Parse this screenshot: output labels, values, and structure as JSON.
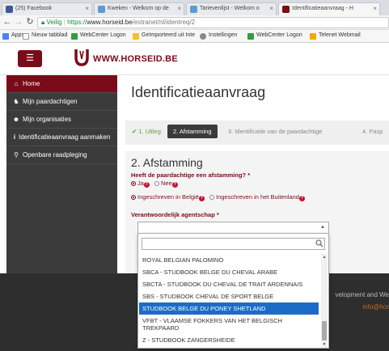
{
  "browser": {
    "tabs": [
      {
        "label": "(25) Facebook",
        "color": "#3b5998"
      },
      {
        "label": "Kweken - Welkom op de",
        "color": "#5b9bd5"
      },
      {
        "label": "Tarievenlijst - Welkom o",
        "color": "#5b9bd5"
      },
      {
        "label": "Identificatieaanvraag - H",
        "color": "#7a0c1a"
      }
    ],
    "url": {
      "secure_label": "Veilig",
      "protocol": "https://",
      "host": "www.horseid.be",
      "path": "/extranet/nl/identreq/2"
    },
    "bookmarks": [
      {
        "label": "Apps",
        "color": "#4285f4"
      },
      {
        "label": "Nieuw tabblad",
        "color": "#bbbbbb"
      },
      {
        "label": "WebCenter Logon",
        "color": "#2e9e44"
      },
      {
        "label": "Geïmporteerd uit Inte",
        "color": "#f2c12e"
      },
      {
        "label": "Instellingen",
        "color": "#888888"
      },
      {
        "label": "WebCenter Logon",
        "color": "#2e9e44"
      },
      {
        "label": "Telenet Webmail",
        "color": "#f7a600"
      }
    ]
  },
  "site": {
    "logo_text": "WWW.HORSEID.BE",
    "brand_color": "#7a0c1a"
  },
  "sidebar": {
    "items": [
      {
        "label": "Home",
        "icon": "home-icon"
      },
      {
        "label": "Mijn paardachtigen",
        "icon": "trophy-icon"
      },
      {
        "label": "Mijn organisaties",
        "icon": "group-icon"
      },
      {
        "label": "Identificatieaanvraag aanmaken",
        "icon": "info-icon"
      },
      {
        "label": "Openbare raadpleging",
        "icon": "search-icon"
      }
    ]
  },
  "main": {
    "title": "Identificatieaanvraag",
    "steps": [
      {
        "label": "1. Uitleg",
        "state": "done"
      },
      {
        "label": "2. Afstamming",
        "state": "current"
      },
      {
        "label": "3. Identificatie van de paardachtige",
        "state": "todo"
      },
      {
        "label": "4. Pasp",
        "state": "todo"
      }
    ],
    "section_title": "2. Afstamming",
    "question": "Heeft de paardachtige een afstamming? *",
    "radios_pedigree": [
      {
        "label": "Ja",
        "checked": true
      },
      {
        "label": "Nee",
        "checked": false
      }
    ],
    "radios_registration": [
      {
        "label": "Ingeschreven in België",
        "checked": true
      },
      {
        "label": "Ingeschreven in het Buitenland",
        "checked": false
      }
    ],
    "agency_label": "Verantwoordelijk agentschap *"
  },
  "footer": {
    "text1": "velopment and We",
    "text2": "info@hor"
  },
  "dropdown": {
    "search_value": "",
    "options": [
      "ROYAL BELGIAN PALOMINO",
      "SBCA - STUDBOOK BELGE DU CHEVAL ARABE",
      "SBCTA - STUDBOOK DU CHEVAL DE TRAIT ARDENNAIS",
      "SBS - STUDBOOK CHEVAL DE SPORT BELGE",
      "STUDBOOK BELGE DU PONEY SHETLAND",
      "VFBT - VLAAMSE FOKKERS VAN HET BELGISCH TREKPAARD",
      "Z - STUDBOOK ZANGERSHEIDE"
    ],
    "selected_index": 4,
    "highlight_color": "#1c6cc7"
  }
}
